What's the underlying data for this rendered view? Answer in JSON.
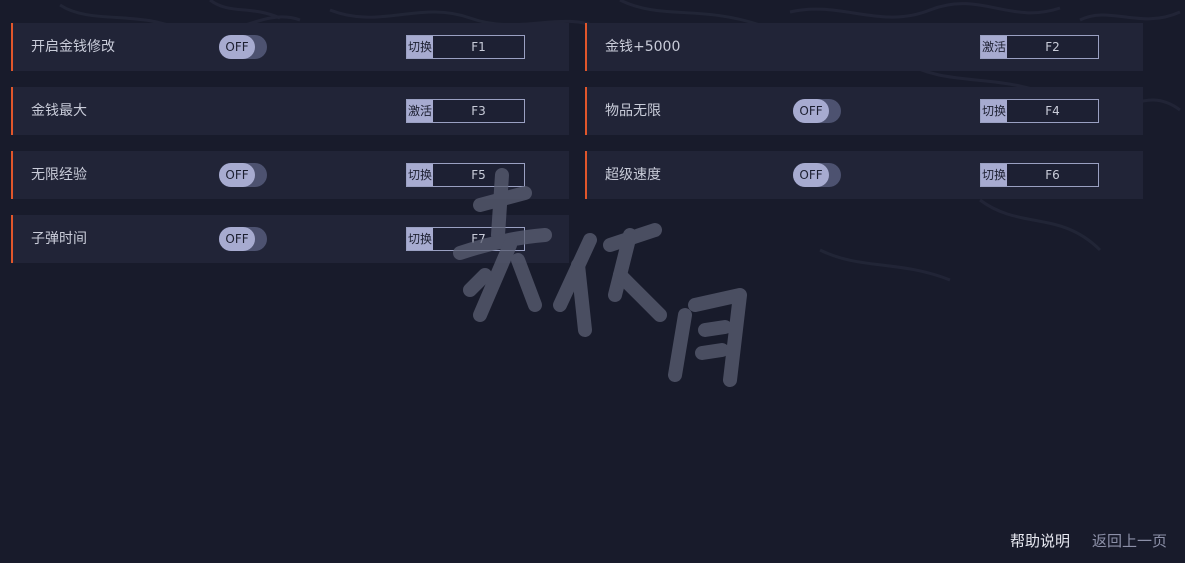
{
  "cheats": [
    {
      "label": "开启金钱修改",
      "has_toggle": true,
      "toggle_state": "OFF",
      "mode": "切换",
      "key": "F1"
    },
    {
      "label": "金钱+5000",
      "has_toggle": false,
      "mode": "激活",
      "key": "F2"
    },
    {
      "label": "金钱最大",
      "has_toggle": false,
      "mode": "激活",
      "key": "F3"
    },
    {
      "label": "物品无限",
      "has_toggle": true,
      "toggle_state": "OFF",
      "mode": "切换",
      "key": "F4"
    },
    {
      "label": "无限经验",
      "has_toggle": true,
      "toggle_state": "OFF",
      "mode": "切换",
      "key": "F5"
    },
    {
      "label": "超级速度",
      "has_toggle": true,
      "toggle_state": "OFF",
      "mode": "切换",
      "key": "F6"
    },
    {
      "label": "子弹时间",
      "has_toggle": true,
      "toggle_state": "OFF",
      "mode": "切换",
      "key": "F7"
    }
  ],
  "footer": {
    "help": "帮助说明",
    "back": "返回上一页"
  },
  "colors": {
    "background": "#181b2b",
    "card": "#212437",
    "accent": "#e1562b",
    "toggle_knob": "#a7abd0"
  }
}
